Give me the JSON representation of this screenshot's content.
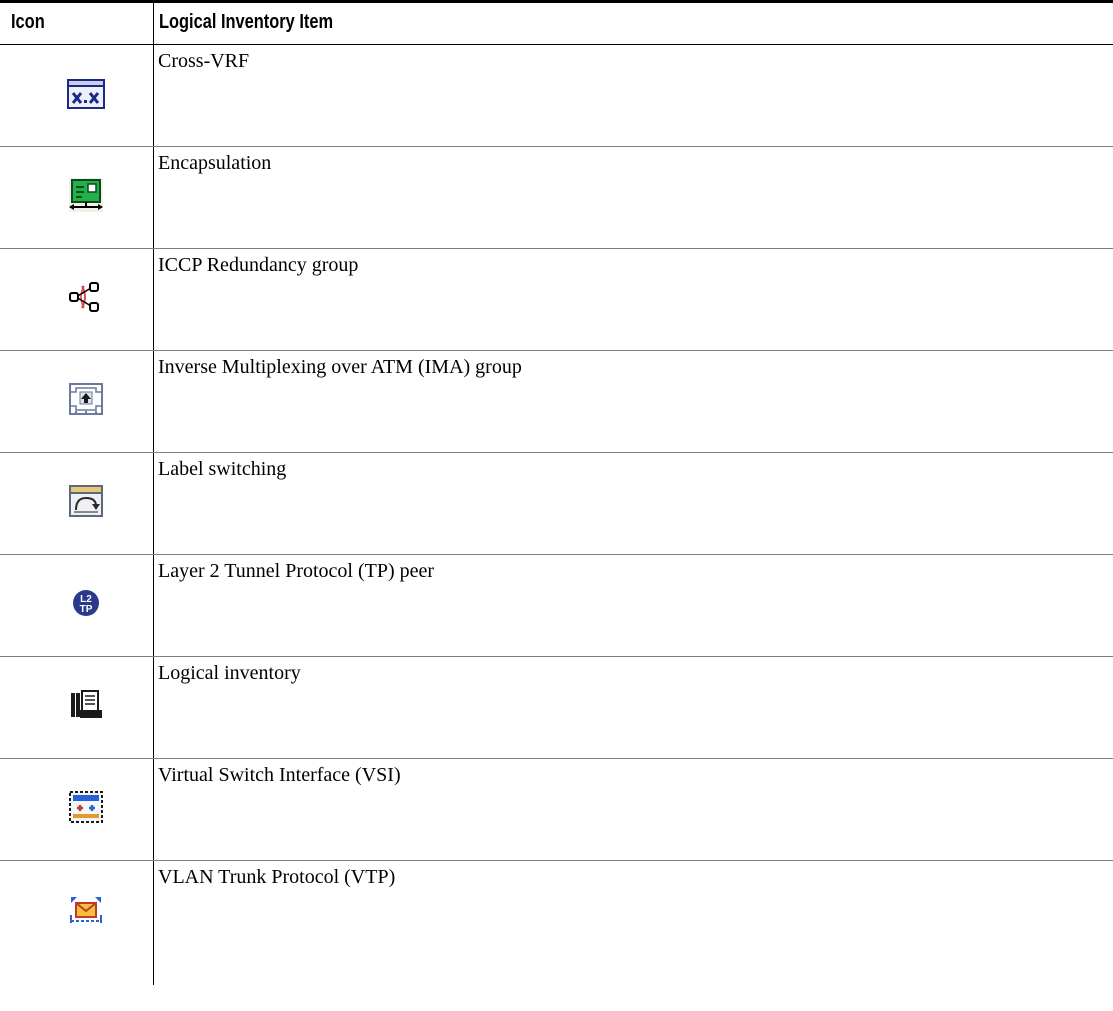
{
  "table": {
    "headers": {
      "icon": "Icon",
      "item": "Logical Inventory Item"
    },
    "rows": [
      {
        "icon": "cross-vrf-icon",
        "label": "Cross-VRF"
      },
      {
        "icon": "encapsulation-icon",
        "label": "Encapsulation"
      },
      {
        "icon": "iccp-redundancy-group-icon",
        "label": "ICCP Redundancy group"
      },
      {
        "icon": "ima-group-icon",
        "label": "Inverse Multiplexing over ATM (IMA) group"
      },
      {
        "icon": "label-switching-icon",
        "label": "Label switching"
      },
      {
        "icon": "l2tp-peer-icon",
        "label": "Layer 2 Tunnel Protocol (TP) peer"
      },
      {
        "icon": "logical-inventory-icon",
        "label": "Logical inventory"
      },
      {
        "icon": "vsi-icon",
        "label": "Virtual Switch Interface (VSI)"
      },
      {
        "icon": "vtp-icon",
        "label": "VLAN Trunk Protocol (VTP)"
      }
    ]
  }
}
